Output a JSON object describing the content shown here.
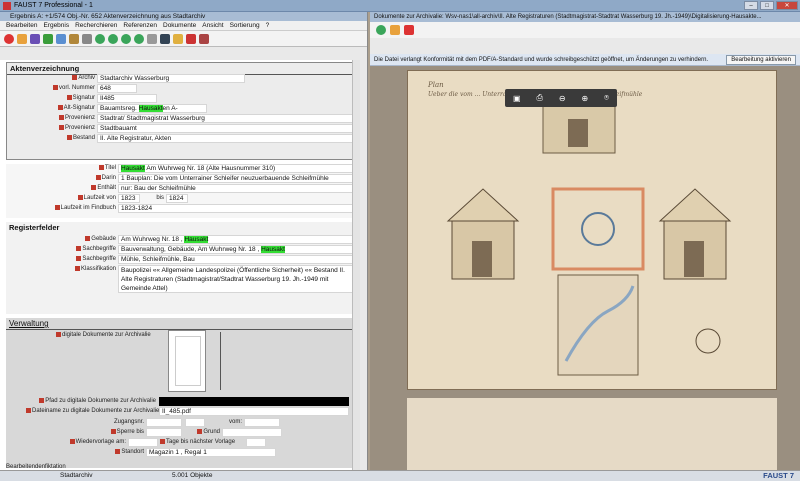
{
  "window": {
    "title": "FAUST 7 Professional - 1",
    "subtitle": "Ergebnis A: +1/574  Obj.-Nr. 652  Aktenverzeichnung aus Stadtarchiv"
  },
  "menu": [
    "Bearbeiten",
    "Ergebnis",
    "Recherchieren",
    "Referenzen",
    "Dokumente",
    "Ansicht",
    "Sortierung",
    "?"
  ],
  "akten": {
    "header": "Aktenverzeichnung",
    "fields": [
      {
        "label": "Archiv",
        "value": "Stadtarchiv Wasserburg"
      },
      {
        "label": "vorl. Nummer",
        "value": "648"
      },
      {
        "label": "Signatur",
        "value": "II485"
      },
      {
        "label": "Alt-Signatur",
        "value_pre": "Bauamtsreg.",
        "value_hl": "Hausakt",
        "value_post": "en A-"
      },
      {
        "label": "Provenienz",
        "value": "Stadtrat/ Stadtmagistrat Wasserburg"
      },
      {
        "label": "Provenienz",
        "value": "Stadtbauamt"
      },
      {
        "label": "Bestand",
        "value": "II. Alte Registratur, Akten"
      }
    ]
  },
  "titel": {
    "label": "Titel",
    "hl": "Hausakt",
    "rest": "Am Wuhrweg Nr. 18 (Alte Hausnummer 310)"
  },
  "darin": {
    "label": "Darin",
    "value": "1 Bauplan: Die vom Unterrainer Schleifer neuzuerbauende Schleifmühle"
  },
  "enthalt": {
    "label": "Enthält",
    "value": "nur: Bau der Schleifmühle"
  },
  "laufzeit": {
    "label": "Laufzeit von",
    "von": "1823",
    "bis_label": "bis",
    "bis": "1824"
  },
  "findbuch": {
    "label": "Laufzeit im Findbuch",
    "value": "1823-1824"
  },
  "register": {
    "header": "Registerfelder",
    "gebaude": {
      "label": "Gebäude",
      "pre": "Am Wuhrweg Nr. 18 ,",
      "hl": "Hausakt"
    },
    "sach1": {
      "label": "Sachbegriffe",
      "pre": "Bauverwaltung, Gebäude, Am Wuhrweg Nr. 18 ,",
      "hl": "Hausakt"
    },
    "sach2": {
      "label": "Sachbegriffe",
      "value": "Mühle, Schleifmühle, Bau"
    },
    "klass": {
      "label": "Klassifikation",
      "value": "Baupolizei «« Allgemeine Landespolizei (Öffentliche Sicherheit) «« Bestand II. Alte Registraturen (Stadtmagistrat/Stadtrat Wasserburg 19. Jh.-1949 mit Gemeinde Attel)"
    }
  },
  "verwaltung": {
    "header": "Verwaltung",
    "digi_label": "digitale Dokumente zur Archivalie",
    "pfad_label": "Pfad zu digitale Dokumente zur Archivalie",
    "datei_label": "Dateiname zu digitale Dokumente zur Archivalie",
    "datei": "II_485.pdf",
    "zugang_label": "Zugangsnr.",
    "vom_label": "vom:",
    "sperre_label": "Sperre bis",
    "grund_label": "Grund",
    "wieder_label": "Wiedervorlage am:",
    "tage_label": "Tage bis nächster Vorlage",
    "standort_label": "Standort",
    "standort": "Magazin 1 , Regal 1",
    "bearb_label": "Bearbeitendenfiktation"
  },
  "status": {
    "left": "Stadtarchiv",
    "count": "5.001 Objekte",
    "brand": "FAUST 7"
  },
  "right": {
    "title": "Dokumente zur Archivalie: Wsv-nas1\\all-archiv\\II. Alte Registraturen (Stadtmagistrat-Stadtrat Wasserburg 19. Jh.-1949)\\Digitalisierung-Hausakte...",
    "notice": "Die Datei verlangt Konformität mit dem PDF/A-Standard und wurde schreibgeschützt geöffnet, um Änderungen zu verhindern.",
    "notice_btn": "Bearbeitung aktivieren",
    "doc_title": "Plan",
    "doc_line": "Ueber die vom ... Unterrainer Schleifer neuzuerbauende Schleifmühle"
  },
  "colors": {
    "highlight": "#33dd33",
    "titlebar": "#8fa9c7"
  }
}
